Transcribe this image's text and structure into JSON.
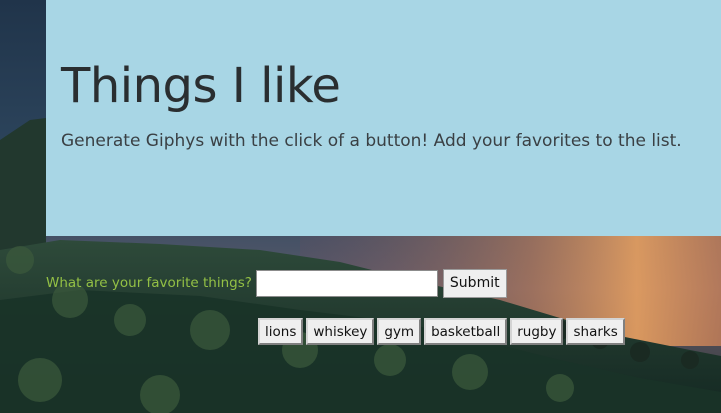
{
  "header": {
    "title": "Things I like",
    "subtitle": "Generate Giphys with the click of a button! Add your favorites to the list."
  },
  "form": {
    "label": "What are your favorite things?",
    "input_value": "",
    "input_placeholder": "",
    "submit_label": "Submit"
  },
  "tags": [
    "lions",
    "whiskey",
    "gym",
    "basketball",
    "rugby",
    "sharks"
  ],
  "colors": {
    "jumbotron_bg": "#a8d6e5",
    "label_color": "#93c045",
    "title_color": "#2a2e30"
  }
}
